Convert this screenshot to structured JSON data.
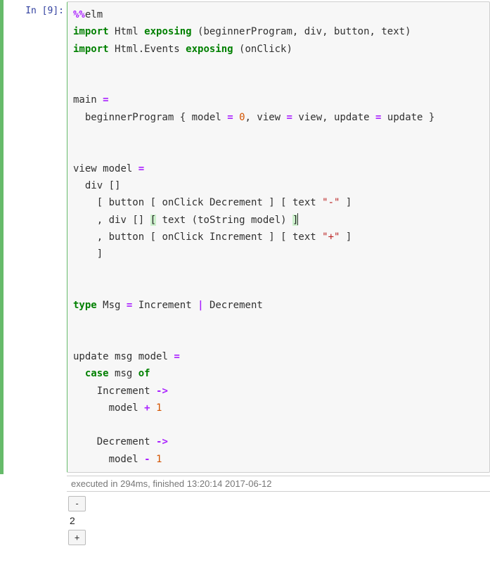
{
  "prompt": {
    "label": "In [9]:"
  },
  "code": {
    "l1_magic": "%%",
    "l1_lang": "elm",
    "l2_kw": "import",
    "l2_mod": "Html",
    "l2_exp": "exposing",
    "l2_open": "(",
    "l2_a": "beginnerProgram",
    "l2_b": "div",
    "l2_c": "button",
    "l2_d": "text",
    "l2_close": ")",
    "l3_kw": "import",
    "l3_mod": "Html.Events",
    "l3_exp": "exposing",
    "l3_open": "(",
    "l3_a": "onClick",
    "l3_close": ")",
    "l6_main": "main",
    "l6_eq": "=",
    "l7_call": "beginnerProgram",
    "l7_brace_o": "{",
    "l7_f1": "model",
    "l7_eq1": "=",
    "l7_v1": "0",
    "l7_c1": ",",
    "l7_f2": "view",
    "l7_eq2": "=",
    "l7_v2": "view",
    "l7_c2": ",",
    "l7_f3": "update",
    "l7_eq3": "=",
    "l7_v3": "update",
    "l7_brace_c": "}",
    "l10_a": "view",
    "l10_b": "model",
    "l10_eq": "=",
    "l11_div": "div",
    "l11_bo": "[",
    "l11_bc": "]",
    "l12_bo": "[",
    "l12_btn": "button",
    "l12_ibo": "[",
    "l12_oc": "onClick",
    "l12_msg": "Decrement",
    "l12_ibc": "]",
    "l12_tbo": "[",
    "l12_txt": "text",
    "l12_str": "\"-\"",
    "l12_tbc": "]",
    "l13_c": ",",
    "l13_div": "div",
    "l13_bo": "[",
    "l13_bc": "]",
    "l13_tbo": "[",
    "l13_txt": "text",
    "l13_po": "(",
    "l13_ts": "toString",
    "l13_m": "model",
    "l13_pc": ")",
    "l13_tbc": "]",
    "l14_c": ",",
    "l14_btn": "button",
    "l14_ibo": "[",
    "l14_oc": "onClick",
    "l14_msg": "Increment",
    "l14_ibc": "]",
    "l14_tbo": "[",
    "l14_txt": "text",
    "l14_str": "\"+\"",
    "l14_tbc": "]",
    "l15_close": "]",
    "l18_kw": "type",
    "l18_name": "Msg",
    "l18_eq": "=",
    "l18_a": "Increment",
    "l18_pipe": "|",
    "l18_b": "Decrement",
    "l21_a": "update",
    "l21_b": "msg",
    "l21_c": "model",
    "l21_eq": "=",
    "l22_case": "case",
    "l22_v": "msg",
    "l22_of": "of",
    "l23_c": "Increment",
    "l23_arrow": "->",
    "l24_m": "model",
    "l24_op": "+",
    "l24_n": "1",
    "l26_c": "Decrement",
    "l26_arrow": "->",
    "l27_m": "model",
    "l27_op": "-",
    "l27_n": "1"
  },
  "output": {
    "exec_meta": "executed in 294ms, finished 13:20:14 2017-06-12",
    "btn_minus": "-",
    "counter": "2",
    "btn_plus": "+"
  }
}
